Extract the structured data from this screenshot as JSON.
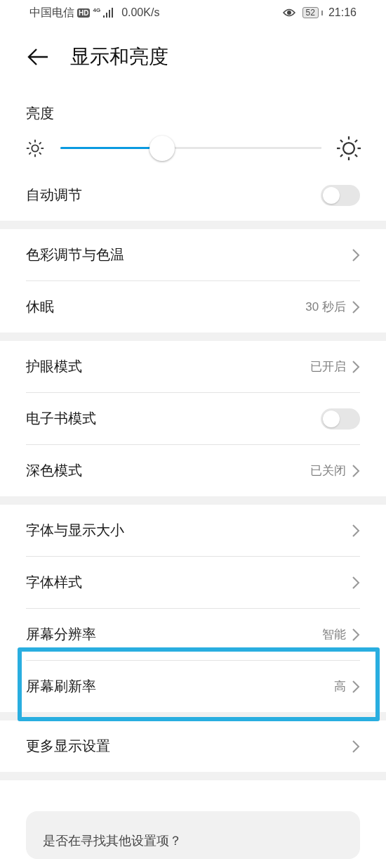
{
  "status_bar": {
    "carrier": "中国电信",
    "hd": "HD",
    "network": "4G",
    "speed": "0.00K/s",
    "battery": "52",
    "time": "21:16"
  },
  "header": {
    "title": "显示和亮度"
  },
  "groups": [
    [
      {
        "kind": "slider",
        "label": "亮度",
        "level": 0.39
      },
      {
        "kind": "toggle",
        "label": "自动调节",
        "on": false
      }
    ],
    [
      {
        "kind": "link",
        "label": "色彩调节与色温",
        "highlighted": false
      },
      {
        "kind": "link",
        "label": "休眠",
        "value": "30 秒后",
        "highlighted": false
      }
    ],
    [
      {
        "kind": "link",
        "label": "护眼模式",
        "value": "已开启",
        "highlighted": false
      },
      {
        "kind": "toggle",
        "label": "电子书模式",
        "on": false
      },
      {
        "kind": "link",
        "label": "深色模式",
        "value": "已关闭",
        "highlighted": false
      }
    ],
    [
      {
        "kind": "link",
        "label": "字体与显示大小",
        "highlighted": false
      },
      {
        "kind": "link",
        "label": "字体样式",
        "highlighted": false
      },
      {
        "kind": "link",
        "label": "屏幕分辨率",
        "value": "智能",
        "highlighted": false
      },
      {
        "kind": "link",
        "label": "屏幕刷新率",
        "value": "高",
        "highlighted": true
      }
    ],
    [
      {
        "kind": "link",
        "label": "更多显示设置",
        "highlighted": false
      }
    ]
  ],
  "help_card": {
    "title": "是否在寻找其他设置项？"
  }
}
